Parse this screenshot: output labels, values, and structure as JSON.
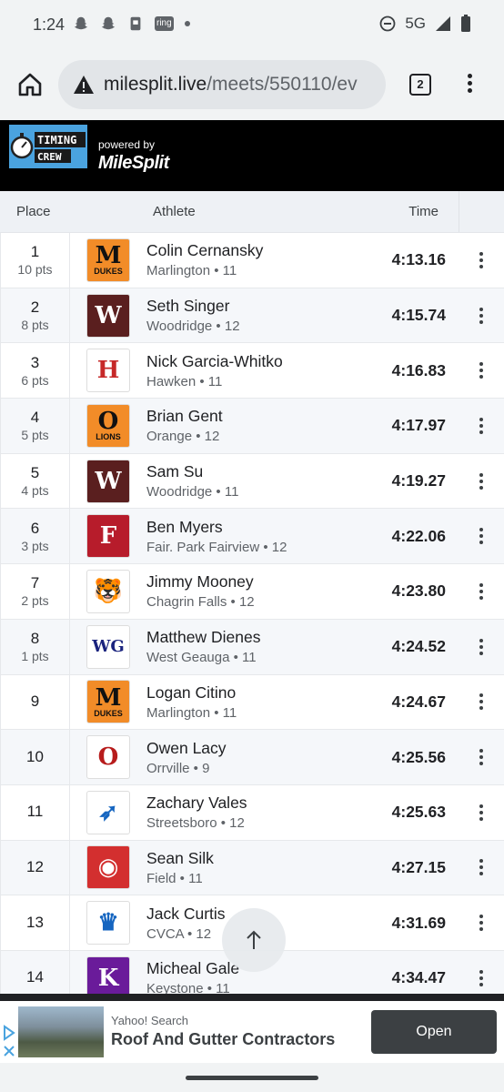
{
  "status": {
    "time": "1:24",
    "ring": "ring",
    "network": "5G"
  },
  "browser": {
    "url_host": "milesplit.live",
    "url_path": "/meets/550110/ev",
    "tab_count": "2"
  },
  "banner": {
    "logo_line1": "TIMING",
    "logo_line2": "CREW",
    "powered_by": "powered by",
    "brand": "MileSplit"
  },
  "table": {
    "headers": {
      "place": "Place",
      "athlete": "Athlete",
      "time": "Time"
    },
    "rows": [
      {
        "place": "1",
        "pts": "10 pts",
        "name": "Colin Cernansky",
        "meta": "Marlington • 11",
        "time": "4:13.16",
        "logo": "M",
        "logo_caption": "DUKES",
        "logo_bg": "#f28c28",
        "logo_fg": "#111111"
      },
      {
        "place": "2",
        "pts": "8 pts",
        "name": "Seth Singer",
        "meta": "Woodridge • 12",
        "time": "4:15.74",
        "logo": "W",
        "logo_caption": "",
        "logo_bg": "#5a1f1f",
        "logo_fg": "#ffffff"
      },
      {
        "place": "3",
        "pts": "6 pts",
        "name": "Nick Garcia-Whitko",
        "meta": "Hawken • 11",
        "time": "4:16.83",
        "logo": "H",
        "logo_caption": "",
        "logo_bg": "#ffffff",
        "logo_fg": "#c62828"
      },
      {
        "place": "4",
        "pts": "5 pts",
        "name": "Brian Gent",
        "meta": "Orange • 12",
        "time": "4:17.97",
        "logo": "O",
        "logo_caption": "LIONS",
        "logo_bg": "#f28c28",
        "logo_fg": "#111111"
      },
      {
        "place": "5",
        "pts": "4 pts",
        "name": "Sam Su",
        "meta": "Woodridge • 11",
        "time": "4:19.27",
        "logo": "W",
        "logo_caption": "",
        "logo_bg": "#5a1f1f",
        "logo_fg": "#ffffff"
      },
      {
        "place": "6",
        "pts": "3 pts",
        "name": "Ben Myers",
        "meta": "Fair. Park Fairview • 12",
        "time": "4:22.06",
        "logo": "F",
        "logo_caption": "",
        "logo_bg": "#b71c2b",
        "logo_fg": "#ffffff"
      },
      {
        "place": "7",
        "pts": "2 pts",
        "name": "Jimmy Mooney",
        "meta": "Chagrin Falls • 12",
        "time": "4:23.80",
        "logo": "🐯",
        "logo_caption": "",
        "logo_bg": "#ffffff",
        "logo_fg": "#e67e22"
      },
      {
        "place": "8",
        "pts": "1 pts",
        "name": "Matthew Dienes",
        "meta": "West Geauga • 11",
        "time": "4:24.52",
        "logo": "WG",
        "logo_caption": "",
        "logo_bg": "#ffffff",
        "logo_fg": "#1a237e"
      },
      {
        "place": "9",
        "pts": "",
        "name": "Logan Citino",
        "meta": "Marlington • 11",
        "time": "4:24.67",
        "logo": "M",
        "logo_caption": "DUKES",
        "logo_bg": "#f28c28",
        "logo_fg": "#111111"
      },
      {
        "place": "10",
        "pts": "",
        "name": "Owen Lacy",
        "meta": "Orrville • 9",
        "time": "4:25.56",
        "logo": "O",
        "logo_caption": "",
        "logo_bg": "#ffffff",
        "logo_fg": "#b71c1c"
      },
      {
        "place": "11",
        "pts": "",
        "name": "Zachary Vales",
        "meta": "Streetsboro • 12",
        "time": "4:25.63",
        "logo": "➶",
        "logo_caption": "",
        "logo_bg": "#ffffff",
        "logo_fg": "#1565c0"
      },
      {
        "place": "12",
        "pts": "",
        "name": "Sean Silk",
        "meta": "Field • 11",
        "time": "4:27.15",
        "logo": "◉",
        "logo_caption": "",
        "logo_bg": "#d32f2f",
        "logo_fg": "#ffffff"
      },
      {
        "place": "13",
        "pts": "",
        "name": "Jack Curtis",
        "meta": "CVCA • 12",
        "time": "4:31.69",
        "logo": "♛",
        "logo_caption": "",
        "logo_bg": "#ffffff",
        "logo_fg": "#1565c0"
      },
      {
        "place": "14",
        "pts": "",
        "name": "Micheal Gale",
        "meta": "Keystone • 11",
        "time": "4:34.47",
        "logo": "K",
        "logo_caption": "",
        "logo_bg": "#6a1b9a",
        "logo_fg": "#ffffff"
      }
    ]
  },
  "scroll_top": {
    "icon": "up-arrow-icon"
  },
  "ad": {
    "source": "Yahoo! Search",
    "title": "Roof And Gutter Contractors",
    "cta": "Open"
  }
}
